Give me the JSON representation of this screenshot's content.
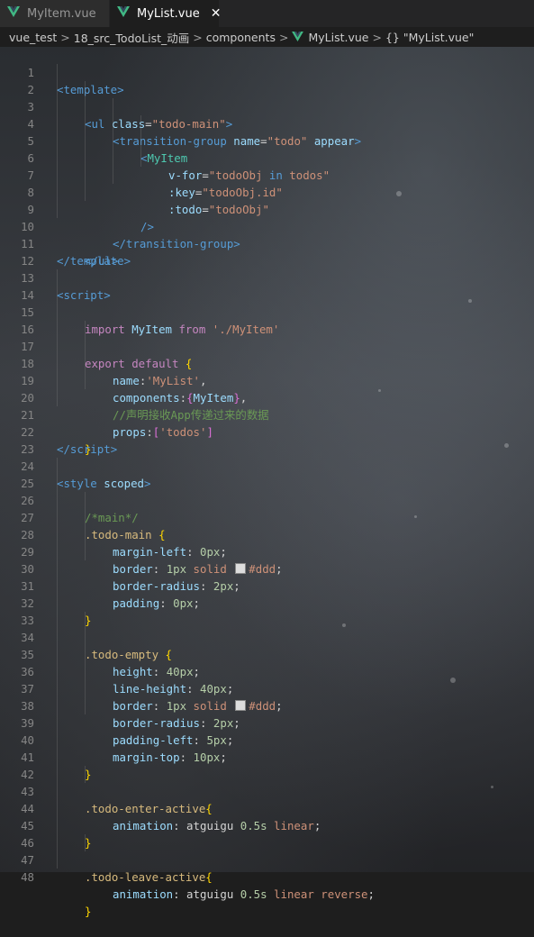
{
  "tabs": [
    {
      "label": "MyItem.vue",
      "active": false,
      "icon": "vue-icon"
    },
    {
      "label": "MyList.vue",
      "active": true,
      "icon": "vue-icon",
      "close": "✕"
    }
  ],
  "breadcrumb": {
    "parts": [
      "vue_test",
      "18_src_TodoList_动画",
      "components",
      "MyList.vue",
      "{} \"MyList.vue\""
    ],
    "separator": ">"
  },
  "editor": {
    "line_numbers": [
      "1",
      "2",
      "3",
      "4",
      "5",
      "6",
      "7",
      "8",
      "9",
      "10",
      "11",
      "12",
      "13",
      "14",
      "15",
      "16",
      "17",
      "18",
      "19",
      "20",
      "21",
      "22",
      "23",
      "24",
      "25",
      "26",
      "27",
      "28",
      "29",
      "30",
      "31",
      "32",
      "33",
      "34",
      "35",
      "36",
      "37",
      "38",
      "39",
      "40",
      "41",
      "42",
      "43",
      "44",
      "45",
      "46",
      "47",
      "48"
    ],
    "lines": {
      "l1": {
        "a": "<",
        "b": "template",
        "c": ">"
      },
      "l2": {
        "a": "<",
        "b": "ul",
        "c": " class",
        "d": "=",
        "e": "\"todo-main\"",
        "f": ">"
      },
      "l3": {
        "a": "<",
        "b": "transition-group",
        "c": " name",
        "d": "=",
        "e": "\"todo\"",
        "f": " appear",
        "g": ">"
      },
      "l4": {
        "a": "<",
        "b": "MyItem"
      },
      "l5": {
        "a": "v-for",
        "b": "=",
        "c": "\"todoObj ",
        "d": "in",
        "e": " todos\""
      },
      "l6": {
        "a": ":key",
        "b": "=",
        "c": "\"todoObj.id\""
      },
      "l7": {
        "a": ":todo",
        "b": "=",
        "c": "\"todoObj\""
      },
      "l8": {
        "a": "/>"
      },
      "l9": {
        "a": "</",
        "b": "transition-group",
        "c": ">"
      },
      "l10": {
        "a": "</",
        "b": "ul",
        "c": ">"
      },
      "l11": {
        "a": "</",
        "b": "template",
        "c": ">"
      },
      "l13": {
        "a": "<",
        "b": "script",
        "c": ">"
      },
      "l14": {
        "a": "import",
        "b": " MyItem ",
        "c": "from",
        "d": " './MyItem'"
      },
      "l16": {
        "a": "export",
        "b": " default ",
        "c": "{"
      },
      "l17": {
        "a": "name",
        "b": ":",
        "c": "'MyList'",
        "d": ","
      },
      "l18": {
        "a": "components",
        "b": ":",
        "c": "{",
        "d": "MyItem",
        "e": "}",
        "f": ","
      },
      "l19": {
        "a": "//声明接收App传递过来的数据"
      },
      "l20": {
        "a": "props",
        "b": ":",
        "c": "[",
        "d": "'todos'",
        "e": "]"
      },
      "l21": {
        "a": "}"
      },
      "l22": {
        "a": "</",
        "b": "script",
        "c": ">"
      },
      "l24": {
        "a": "<",
        "b": "style",
        "c": " scoped",
        "d": ">"
      },
      "l25": {
        "a": "/*main*/"
      },
      "l26": {
        "a": ".todo-main",
        "b": " {"
      },
      "l27": {
        "a": "margin-left",
        "b": ": ",
        "c": "0px",
        "d": ";"
      },
      "l28": {
        "a": "border",
        "b": ": ",
        "c": "1px",
        "d": " solid ",
        "e": "#ddd",
        "f": ";"
      },
      "l29": {
        "a": "border-radius",
        "b": ": ",
        "c": "2px",
        "d": ";"
      },
      "l30": {
        "a": "padding",
        "b": ": ",
        "c": "0px",
        "d": ";"
      },
      "l31": {
        "a": "}"
      },
      "l33": {
        "a": ".todo-empty",
        "b": " {"
      },
      "l34": {
        "a": "height",
        "b": ": ",
        "c": "40px",
        "d": ";"
      },
      "l35": {
        "a": "line-height",
        "b": ": ",
        "c": "40px",
        "d": ";"
      },
      "l36": {
        "a": "border",
        "b": ": ",
        "c": "1px",
        "d": " solid ",
        "e": "#ddd",
        "f": ";"
      },
      "l37": {
        "a": "border-radius",
        "b": ": ",
        "c": "2px",
        "d": ";"
      },
      "l38": {
        "a": "padding-left",
        "b": ": ",
        "c": "5px",
        "d": ";"
      },
      "l39": {
        "a": "margin-top",
        "b": ": ",
        "c": "10px",
        "d": ";"
      },
      "l40": {
        "a": "}"
      },
      "l42": {
        "a": ".todo-enter-active",
        "b": "{"
      },
      "l43": {
        "a": "animation",
        "b": ": atguigu ",
        "c": "0.5s",
        "d": " linear",
        "e": ";"
      },
      "l44": {
        "a": "}"
      },
      "l46": {
        "a": ".todo-leave-active",
        "b": "{"
      },
      "l47": {
        "a": "animation",
        "b": ": atguigu ",
        "c": "0.5s",
        "d": " linear reverse",
        "e": ";"
      },
      "l48": {
        "a": "}"
      }
    }
  },
  "colors": {
    "tag": "#569cd6",
    "attr": "#9cdcfe",
    "string": "#ce9178",
    "keyword": "#c586c0",
    "comment": "#6a9955",
    "selector": "#d7ba7d",
    "number": "#b5cea8",
    "swatch": "#dddddd"
  }
}
